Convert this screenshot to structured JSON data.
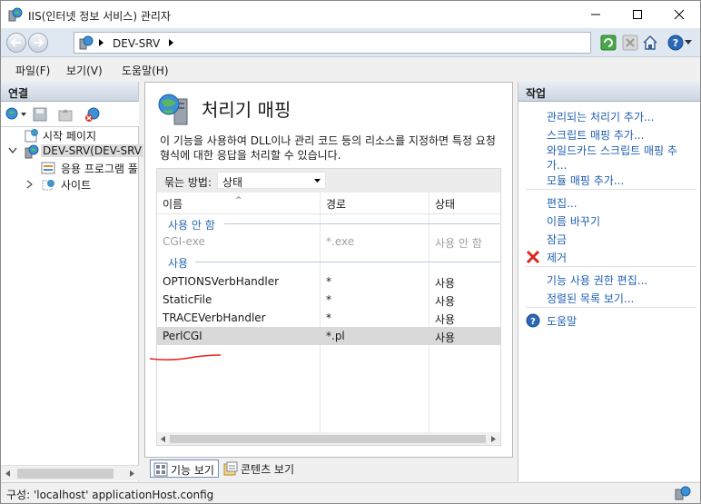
{
  "window": {
    "title": "IIS(인터넷 정보 서비스) 관리자"
  },
  "address": {
    "crumb": "DEV-SRV"
  },
  "menu": {
    "file": "파일(F)",
    "view": "보기(V)",
    "help": "도움말(H)"
  },
  "connections": {
    "header": "연결",
    "tree": {
      "start_page": "시작 페이지",
      "server": "DEV-SRV(DEV-SRV",
      "app_pools": "응용 프로그램 풀",
      "sites": "사이트"
    }
  },
  "feature": {
    "title": "처리기 매핑",
    "description": "이 기능을 사용하여 DLL이나 관리 코드 등의 리소스를 지정하면 특정 요청 형식에 대한 응답을 처리할 수 있습니다.",
    "group_by_label": "묶는 방법:",
    "group_by_value": "상태",
    "columns": {
      "name": "이름",
      "path": "경로",
      "state": "상태"
    },
    "groups": [
      {
        "title": "사용 안 함",
        "rows": [
          {
            "name": "CGI-exe",
            "path": "*.exe",
            "state": "사용 안 함"
          }
        ]
      },
      {
        "title": "사용",
        "rows": [
          {
            "name": "OPTIONSVerbHandler",
            "path": "*",
            "state": "사용"
          },
          {
            "name": "StaticFile",
            "path": "*",
            "state": "사용"
          },
          {
            "name": "TRACEVerbHandler",
            "path": "*",
            "state": "사용"
          },
          {
            "name": "PerlCGI",
            "path": "*.pl",
            "state": "사용"
          }
        ]
      }
    ]
  },
  "view_tabs": {
    "features": "기능 보기",
    "content": "콘텐츠 보기"
  },
  "actions": {
    "header": "작업",
    "add_managed": "관리되는 처리기 추가...",
    "add_script": "스크립트 매핑 추가...",
    "add_wildcard_1": "와일드카드 스크립트 매핑 추",
    "add_wildcard_2": "가...",
    "add_module": "모듈 매핑 추가...",
    "edit": "편집...",
    "rename": "이름 바꾸기",
    "lock": "잠금",
    "remove": "제거",
    "edit_permissions": "기능 사용 권한 편집...",
    "ordered_list": "정렬된 목록 보기...",
    "help": "도움말"
  },
  "status": {
    "text": "구성: 'localhost' applicationHost.config"
  }
}
